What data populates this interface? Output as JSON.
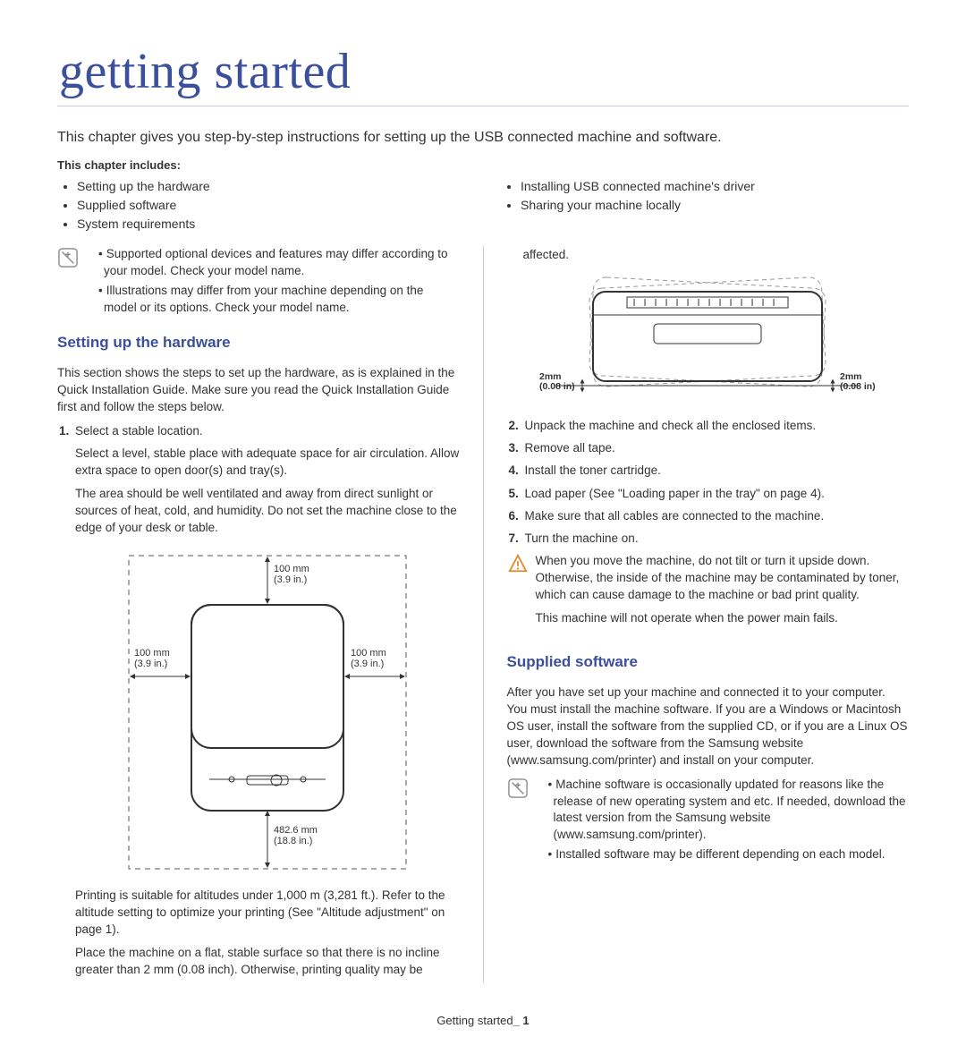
{
  "title": "getting started",
  "intro": "This chapter gives you step-by-step instructions for setting up the USB connected machine and software.",
  "includes_label": "This chapter includes:",
  "contents_left": [
    "Setting up the hardware",
    "Supplied software",
    "System requirements"
  ],
  "contents_right": [
    "Installing USB connected machine's driver",
    "Sharing your machine locally"
  ],
  "top_notes": [
    "Supported optional devices and features may differ according to your model. Check your model name.",
    "Illustrations may differ from your machine depending on the model or its options. Check your model name."
  ],
  "section_hardware": {
    "heading": "Setting up the hardware",
    "intro": "This section shows the steps to set up the hardware, as is explained in the Quick Installation Guide. Make sure you read the Quick Installation Guide first and follow the steps below.",
    "step1_lead": "Select a stable location.",
    "step1_paras": [
      "Select a level, stable place with adequate space for air circulation. Allow extra space to open door(s) and tray(s).",
      "The area should be well ventilated and away from direct sunlight or sources of heat, cold, and humidity. Do not set the machine close to the edge of your desk or table."
    ],
    "fig1_labels": {
      "top": "100 mm\n(3.9 in.)",
      "left": "100 mm\n(3.9 in.)",
      "right": "100 mm\n(3.9 in.)",
      "bottom": "482.6 mm\n(18.8 in.)"
    },
    "step1_after": [
      "Printing is suitable for altitudes under 1,000 m (3,281 ft.). Refer to the altitude setting to optimize your printing (See \"Altitude adjustment\" on page 1).",
      "Place the machine on a flat, stable surface so that there is no incline greater than 2 mm (0.08 inch). Otherwise, printing quality may be"
    ]
  },
  "right_top_word": "affected.",
  "fig2_labels": {
    "left": "2mm\n(0.08 in)",
    "right": "2mm\n(0.08 in)"
  },
  "steps_continued": [
    {
      "n": "2.",
      "text": "Unpack the machine and check all the enclosed items."
    },
    {
      "n": "3.",
      "text": "Remove all tape."
    },
    {
      "n": "4.",
      "text": "Install the toner cartridge."
    },
    {
      "n": "5.",
      "text": "Load paper (See \"Loading paper in the tray\" on page 4)."
    },
    {
      "n": "6.",
      "text": "Make sure that all cables are connected to the machine."
    },
    {
      "n": "7.",
      "text": "Turn the machine on."
    }
  ],
  "warning_paras": [
    "When you move the machine, do not tilt or turn it upside down. Otherwise, the inside of the machine may be contaminated by toner, which can cause damage to the machine or bad print quality.",
    "This machine will not operate when the power main fails."
  ],
  "section_software": {
    "heading": "Supplied software",
    "para": "After you have set up your machine and connected it to your computer. You must install the machine software. If you are a Windows or Macintosh OS user, install the software from the supplied CD, or if you are a Linux OS user, download the software from the Samsung website (www.samsung.com/printer) and install on your computer.",
    "notes": [
      "Machine software is occasionally updated for reasons like the release of new operating system and etc. If needed, download the latest version from the Samsung website (www.samsung.com/printer).",
      "Installed software may be different depending on each model."
    ]
  },
  "footer_text": "Getting started",
  "footer_page": "_ 1"
}
